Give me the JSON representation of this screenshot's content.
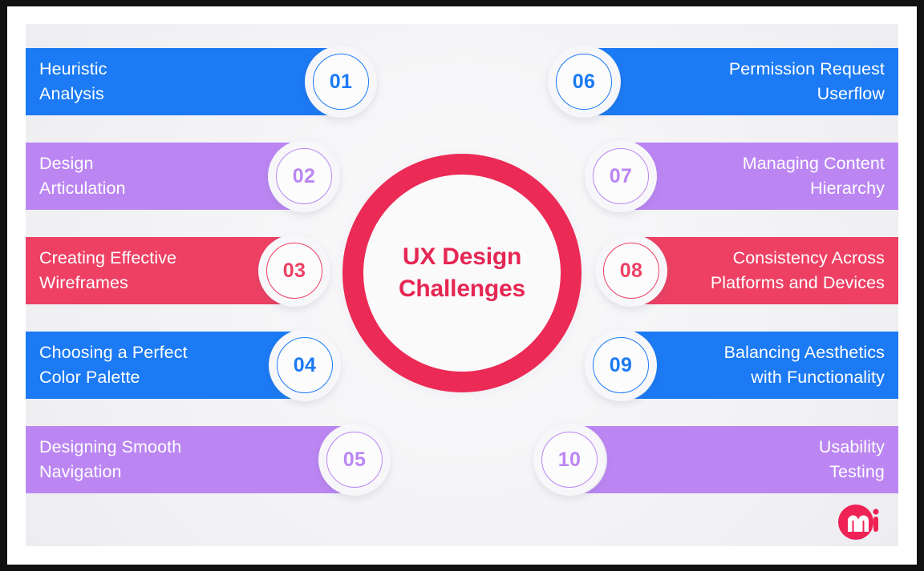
{
  "center": {
    "title": "UX Design\nChallenges",
    "ring_color": "#EC2A56",
    "text_color": "#E62753"
  },
  "colors": {
    "blue": "#1B7AF4",
    "purple": "#BB86F2",
    "pink": "#ED4063",
    "background": "#F4F4F7",
    "badge_disc": "#F7F7F9",
    "label_text": "#FFFFFF"
  },
  "items": [
    {
      "number": "01",
      "label": "Heuristic\nAnalysis",
      "side": "left",
      "color": "#1B7AF4",
      "row": 1
    },
    {
      "number": "02",
      "label": "Design\nArticulation",
      "side": "left",
      "color": "#BB86F2",
      "row": 2
    },
    {
      "number": "03",
      "label": "Creating Effective\nWireframes",
      "side": "left",
      "color": "#ED4063",
      "row": 3
    },
    {
      "number": "04",
      "label": "Choosing a Perfect\nColor Palette",
      "side": "left",
      "color": "#1B7AF4",
      "row": 4
    },
    {
      "number": "05",
      "label": "Designing Smooth\nNavigation",
      "side": "left",
      "color": "#BB86F2",
      "row": 5
    },
    {
      "number": "06",
      "label": "Permission Request\nUserflow",
      "side": "right",
      "color": "#1B7AF4",
      "row": 1
    },
    {
      "number": "07",
      "label": "Managing Content\nHierarchy",
      "side": "right",
      "color": "#BB86F2",
      "row": 2
    },
    {
      "number": "08",
      "label": "Consistency Across\nPlatforms and Devices",
      "side": "right",
      "color": "#ED4063",
      "row": 3
    },
    {
      "number": "09",
      "label": "Balancing Aesthetics\nwith Functionality",
      "side": "right",
      "color": "#1B7AF4",
      "row": 4
    },
    {
      "number": "10",
      "label": "Usability\nTesting",
      "side": "right",
      "color": "#BB86F2",
      "row": 5
    }
  ],
  "logo": {
    "name": "mi-logo",
    "mark_letter": "m",
    "word_letter": "i",
    "color": "#EE2255"
  }
}
